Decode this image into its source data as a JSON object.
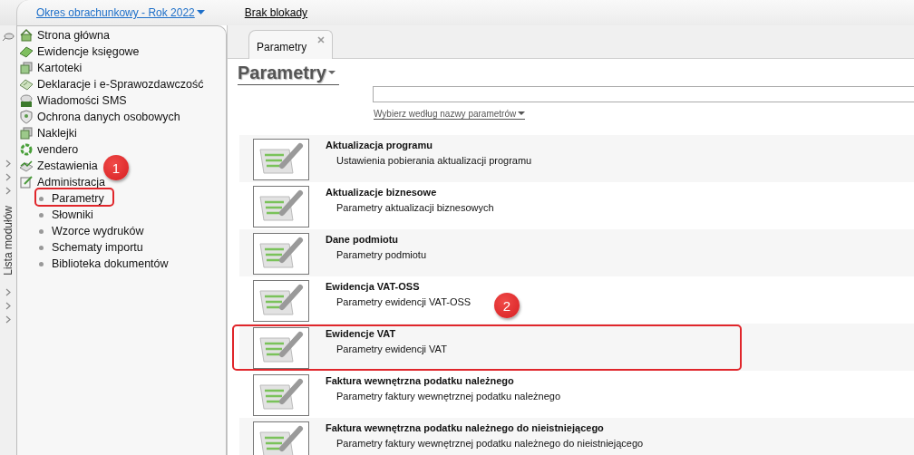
{
  "header": {
    "period_link": "Okres obrachunkowy - Rok 2022",
    "lock_status": "Brak blokady"
  },
  "module_strip": {
    "label": "Lista modułów"
  },
  "sidebar": {
    "items": [
      {
        "label": "Strona główna",
        "kind": "home"
      },
      {
        "label": "Ewidencje księgowe",
        "kind": "book"
      },
      {
        "label": "Kartoteki",
        "kind": "cards"
      },
      {
        "label": "Deklaracje i e-Sprawozdawczość",
        "kind": "declaration"
      },
      {
        "label": "Wiadomości SMS",
        "kind": "sms"
      },
      {
        "label": "Ochrona danych osobowych",
        "kind": "shield"
      },
      {
        "label": "Naklejki",
        "kind": "cards"
      },
      {
        "label": "vendero",
        "kind": "ring"
      },
      {
        "label": "Zestawienia",
        "kind": "chart"
      },
      {
        "label": "Administracja",
        "kind": "edit",
        "children": [
          {
            "label": "Parametry"
          },
          {
            "label": "Słowniki"
          },
          {
            "label": "Wzorce wydruków"
          },
          {
            "label": "Schematy importu"
          },
          {
            "label": "Biblioteka dokumentów"
          }
        ]
      }
    ]
  },
  "tabs": [
    {
      "label": "Parametry",
      "selected": true
    }
  ],
  "page_title": "Parametry",
  "filter_link": "Wybierz według nazwy parametrów",
  "parameters": [
    {
      "title": "Aktualizacja programu",
      "description": "Ustawienia pobierania aktualizacji programu"
    },
    {
      "title": "Aktualizacje biznesowe",
      "description": "Parametry aktualizacji biznesowych"
    },
    {
      "title": "Dane podmiotu",
      "description": "Parametry podmiotu"
    },
    {
      "title": "Ewidencja VAT-OSS",
      "description": "Parametry ewidencji VAT-OSS"
    },
    {
      "title": "Ewidencje VAT",
      "description": "Parametry ewidencji VAT"
    },
    {
      "title": "Faktura wewnętrzna podatku należnego",
      "description": "Parametry faktury wewnętrznej podatku należnego"
    },
    {
      "title": "Faktura wewnętrzna podatku należnego do nieistniejącego",
      "description": "Parametry faktury wewnętrznej podatku należnego do nieistniejącego"
    }
  ],
  "annotations": [
    {
      "number": "1"
    },
    {
      "number": "2"
    }
  ]
}
